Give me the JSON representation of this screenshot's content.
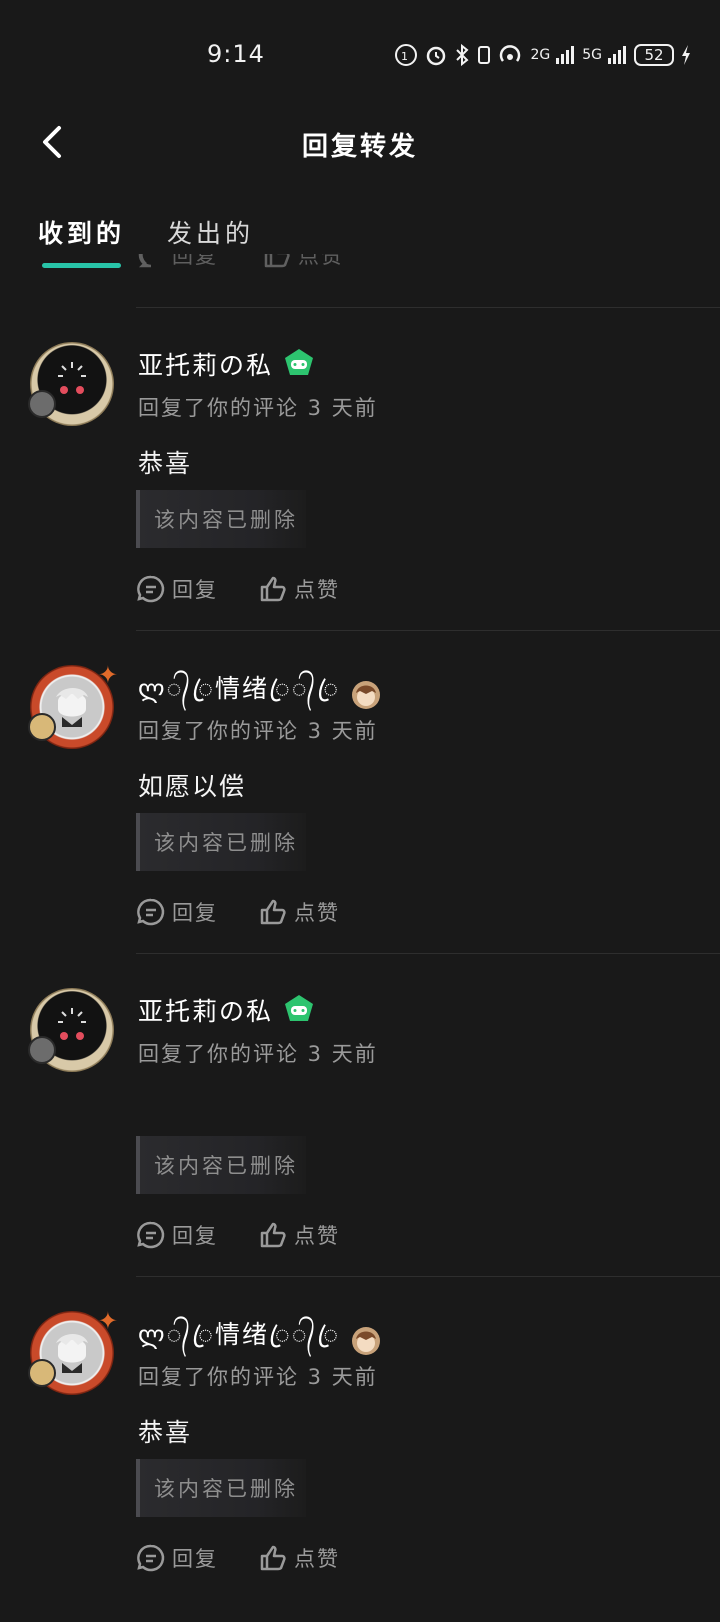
{
  "status_bar": {
    "time": "9:14",
    "network_2g": "2G",
    "network_5g": "5G",
    "battery": "52"
  },
  "header": {
    "title": "回复转发",
    "back_icon": "chevron-left-icon"
  },
  "tabs": [
    {
      "label": "收到的",
      "active": true
    },
    {
      "label": "发出的",
      "active": false
    }
  ],
  "partial_actions": {
    "reply": "回复",
    "like": "点赞"
  },
  "accent_color": "#28c4a8",
  "items": [
    {
      "user": "亚托莉の私",
      "avatar": "black-avatar",
      "medal": "game-controller-badge-icon",
      "meta": "回复了你的评论 3 天前",
      "content": "恭喜",
      "quote": "该内容已删除",
      "reply_label": "回复",
      "like_label": "点赞"
    },
    {
      "user": "ლ᭄ꦿ情绪ꦿ᭄ꦿ",
      "avatar": "red-ring-avatar",
      "medal": "character-avatar-badge",
      "meta": "回复了你的评论 3 天前",
      "content": "如愿以偿",
      "quote": "该内容已删除",
      "reply_label": "回复",
      "like_label": "点赞"
    },
    {
      "user": "亚托莉の私",
      "avatar": "black-avatar",
      "medal": "game-controller-badge-icon",
      "meta": "回复了你的评论 3 天前",
      "content": "",
      "quote": "该内容已删除",
      "reply_label": "回复",
      "like_label": "点赞"
    },
    {
      "user": "ლ᭄ꦿ情绪ꦿ᭄ꦿ",
      "avatar": "red-ring-avatar",
      "medal": "character-avatar-badge",
      "meta": "回复了你的评论 3 天前",
      "content": "恭喜",
      "quote": "该内容已删除",
      "reply_label": "回复",
      "like_label": "点赞"
    }
  ]
}
